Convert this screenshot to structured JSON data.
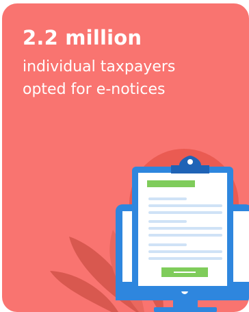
{
  "stat": {
    "value": "2.2 million",
    "caption_line1": "individual taxpayers",
    "caption_line2": "opted for e-notices"
  },
  "colors": {
    "card_background": "#F97470",
    "leaf_dark": "#D8584F",
    "leaf_mid": "#E9685F",
    "circle": "#EA5B52",
    "monitor_frame": "#2E86DE",
    "document_line": "#CFE2F6",
    "document_header": "#7FCC5B",
    "document_button": "#7FCC5B",
    "clip": "#1F63B6"
  },
  "illustration": {
    "icons": [
      "leaf-icon",
      "monitor-icon",
      "clipboard-icon",
      "document-icon"
    ]
  }
}
